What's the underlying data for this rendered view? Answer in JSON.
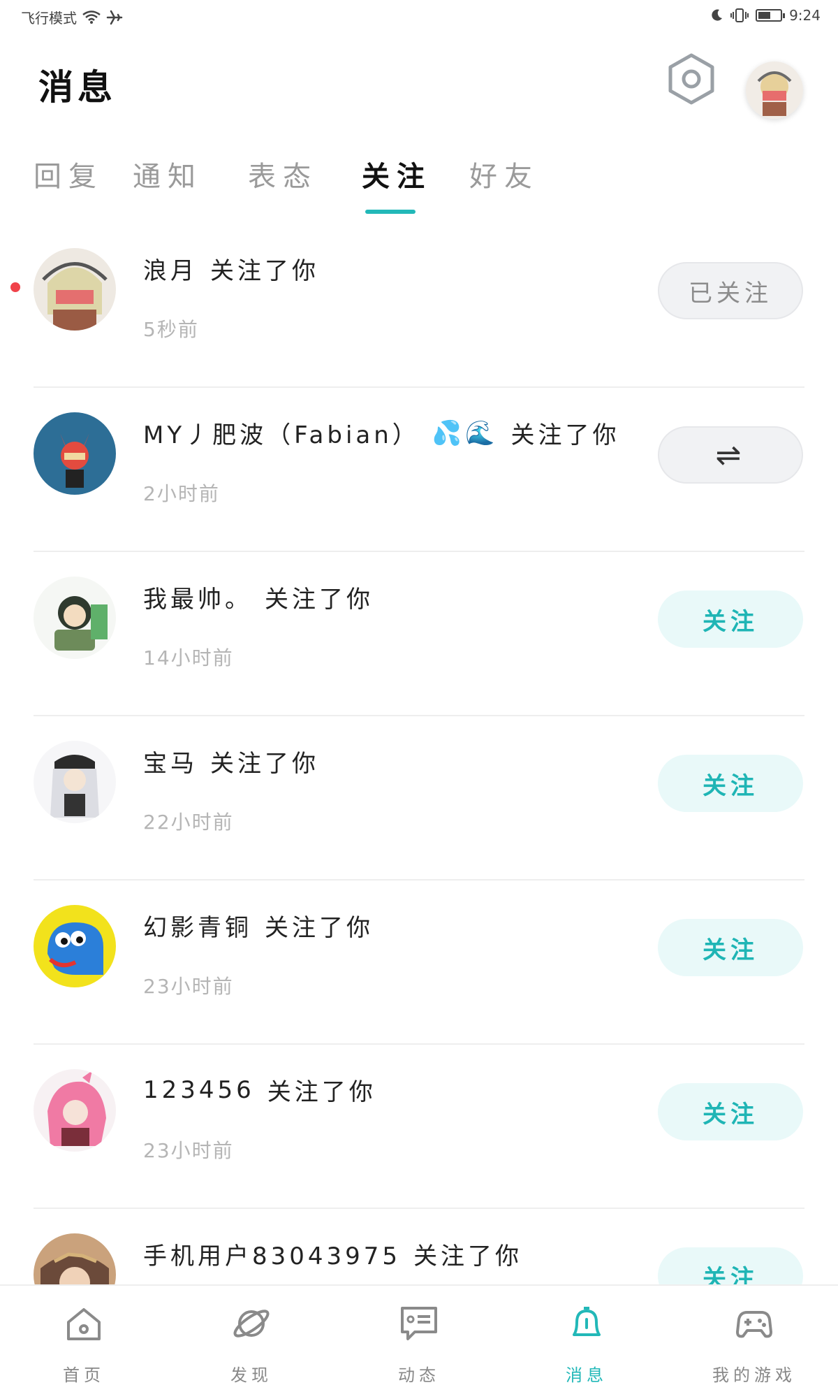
{
  "status_bar": {
    "carrier_text": "飞行模式",
    "time": "9:24",
    "battery_level": 0.55
  },
  "header": {
    "title": "消息"
  },
  "tabs": [
    {
      "label": "回复",
      "active": false
    },
    {
      "label": "通知",
      "active": false
    },
    {
      "label": "表态",
      "active": false
    },
    {
      "label": "关注",
      "active": true
    },
    {
      "label": "好友",
      "active": false
    }
  ],
  "follows": [
    {
      "name": "浪月",
      "action": "关注了你",
      "time": "5秒前",
      "button": "已关注",
      "button_state": "followed",
      "unread": true
    },
    {
      "name": "MY丿肥波（Fabian）",
      "emoji": "💦🌊",
      "action": "关注了你",
      "time": "2小时前",
      "button": "⇌",
      "button_state": "mutual",
      "unread": false
    },
    {
      "name": "我最帅。",
      "action": "关注了你",
      "time": "14小时前",
      "button": "关注",
      "button_state": "follow",
      "unread": false
    },
    {
      "name": "宝马",
      "action": "关注了你",
      "time": "22小时前",
      "button": "关注",
      "button_state": "follow",
      "unread": false
    },
    {
      "name": "幻影青铜",
      "action": "关注了你",
      "time": "23小时前",
      "button": "关注",
      "button_state": "follow",
      "unread": false
    },
    {
      "name": "123456",
      "action": "关注了你",
      "time": "23小时前",
      "button": "关注",
      "button_state": "follow",
      "unread": false
    },
    {
      "name": "手机用户83043975",
      "action": "关注了你",
      "time": "",
      "button": "关注",
      "button_state": "follow",
      "unread": false
    }
  ],
  "bottom_nav": [
    {
      "label": "首页",
      "icon": "home-icon",
      "active": false
    },
    {
      "label": "发现",
      "icon": "planet-icon",
      "active": false
    },
    {
      "label": "动态",
      "icon": "feed-icon",
      "active": false
    },
    {
      "label": "消息",
      "icon": "bell-icon",
      "active": true
    },
    {
      "label": "我的游戏",
      "icon": "gamepad-icon",
      "active": false
    }
  ],
  "colors": {
    "accent": "#22b8b8",
    "unread_dot": "#f0424a",
    "follow_bg": "#e9f9f9"
  }
}
